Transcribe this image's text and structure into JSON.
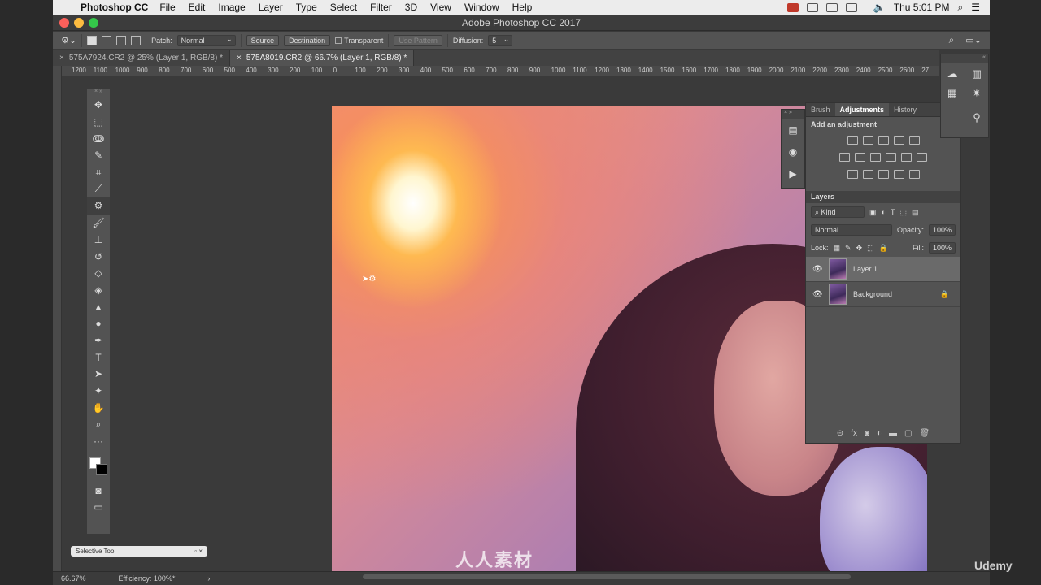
{
  "menubar": {
    "app": "Photoshop CC",
    "items": [
      "File",
      "Edit",
      "Image",
      "Layer",
      "Type",
      "Select",
      "Filter",
      "3D",
      "View",
      "Window",
      "Help"
    ],
    "clock": "Thu 5:01 PM"
  },
  "window": {
    "title": "Adobe Photoshop CC 2017"
  },
  "options": {
    "patch_label": "Patch:",
    "patch_value": "Normal",
    "source": "Source",
    "destination": "Destination",
    "transparent": "Transparent",
    "use_pattern": "Use Pattern",
    "diffusion_label": "Diffusion:",
    "diffusion_value": "5"
  },
  "tabs": [
    {
      "label": "575A7924.CR2 @ 25% (Layer 1, RGB/8) *",
      "active": false
    },
    {
      "label": "575A8019.CR2 @ 66.7% (Layer 1, RGB/8) *",
      "active": true
    }
  ],
  "ruler": [
    "1200",
    "1100",
    "1000",
    "900",
    "800",
    "700",
    "600",
    "500",
    "400",
    "300",
    "200",
    "100",
    "0",
    "100",
    "200",
    "300",
    "400",
    "500",
    "600",
    "700",
    "800",
    "900",
    "1000",
    "1100",
    "1200",
    "1300",
    "1400",
    "1500",
    "1600",
    "1700",
    "1800",
    "1900",
    "2000",
    "2100",
    "2200",
    "2300",
    "2400",
    "2500",
    "2600",
    "27"
  ],
  "panels": {
    "tabs": [
      "Brush",
      "Adjustments",
      "History"
    ],
    "adjust_title": "Add an adjustment",
    "layers_title": "Layers",
    "filter_kind": "Kind",
    "blend_mode": "Normal",
    "opacity_label": "Opacity:",
    "opacity": "100%",
    "lock_label": "Lock:",
    "fill_label": "Fill:",
    "fill": "100%",
    "layers": [
      {
        "name": "Layer 1",
        "selected": true,
        "locked": false
      },
      {
        "name": "Background",
        "selected": false,
        "locked": true
      }
    ]
  },
  "bubble": {
    "label": "Selective Tool"
  },
  "status": {
    "zoom": "66.67%",
    "efficiency": "Efficiency: 100%*"
  },
  "brand": "Udemy",
  "watermark": "人人素材"
}
